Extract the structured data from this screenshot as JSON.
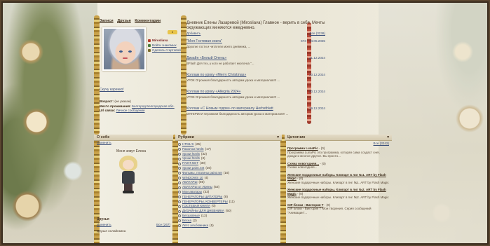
{
  "profile": {
    "tabs": [
      "Записи",
      "Друзья",
      "Комментарии"
    ],
    "username": "Mirosliava",
    "badge": "8",
    "actions": [
      {
        "icon": "person-icon",
        "label": "Mirosliava"
      },
      {
        "icon": "users-icon",
        "label": "Войти знакомых"
      },
      {
        "icon": "post-icon",
        "label": "Сделать стартовой"
      }
    ],
    "mood": "Скучу каренко!",
    "info": [
      {
        "label": "Возраст:",
        "value": "(не указан)"
      },
      {
        "label": "Место проживания:",
        "value": "Белгород Белгородская обл."
      },
      {
        "label": "Url связи:",
        "value": "Личное сообщение"
      }
    ]
  },
  "diary": {
    "title": "Дневник Елены Лазаревой (Mirosliava) Главное - верить в себя. Мечты окружающих меняются ежедневно.",
    "add_label": "Добавить",
    "count_label": "Все (3236)",
    "posts": [
      {
        "title": "\"Моя Гостевая книга\"",
        "desc": "Дорогие гости и читатели моего дневника, ...",
        "date_num": "673",
        "date": "14.05.2035"
      },
      {
        "title": "Дизайн «Белый Олень»",
        "desc": "BFlash Для тех, у кого не работает кнопочка \"...",
        "date_num": "",
        "date": "21.12.2024"
      },
      {
        "title": "Коллаж по уроку «Merry Christmas»",
        "desc": "УРОК Огромная благодарность авторам урока и материалов!!! ...",
        "date_num": "",
        "date": "20.12.2024"
      },
      {
        "title": "Коллаж по уроку «Allegria 2024»",
        "desc": "УРОК Огромная благодарность авторам урока и материалов!!! ...",
        "date_num": "",
        "date": "20.12.2024"
      },
      {
        "title": "Коллаж «С Новым годом» по материалу Herbstblatt",
        "desc": "МАТЕРИАЛ Огромная благодарность авторам урока и материалов!!! ...",
        "date_num": "",
        "date": "19.12.2024"
      }
    ]
  },
  "about": {
    "head": "О себе",
    "edit": "Изменить",
    "greeting": "Меня зовут Елена",
    "friends_head": "Друзья",
    "friends_edit": "Изменить",
    "friends_all": "Все (267)",
    "friends_online": "Друзья онлайнкина"
  },
  "categories": {
    "head": "Рубрики",
    "items": [
      {
        "label": "HTML'S",
        "count": "(25)"
      },
      {
        "label": "Рамочки html5",
        "count": "(17)"
      },
      {
        "label": "Уроки html5",
        "count": "(32)"
      },
      {
        "label": "Уроки html5",
        "count": "(3)"
      },
      {
        "label": "PAINT.NET",
        "count": "(30)"
      },
      {
        "label": "Уроки paint.net",
        "count": "(26)"
      },
      {
        "label": "Фильмы, плагины paint.net",
        "count": "(16)"
      },
      {
        "label": "WINDOWS 10",
        "count": "(4)"
      },
      {
        "label": "АВАТАРЫ",
        "count": "(86)"
      },
      {
        "label": "АВАТАРЫ от Ирены",
        "count": "(53)"
      },
      {
        "label": "Мои аватары",
        "count": "(33)"
      },
      {
        "label": "ГЕНЕРАТОРЫ ЦИТАТОРЫ",
        "count": "(8)"
      },
      {
        "label": "ГЕНЕРАТОРЫ, КОНВЕРТЕРЫ",
        "count": "(11)"
      },
      {
        "label": "ГОСТЕВАЯ КНИГА",
        "count": "(0)"
      },
      {
        "label": "ДИЗАЙНЫ ДЛЯ ДНЕВНИКА",
        "count": "(50)"
      },
      {
        "label": "Бесшовные",
        "count": "(13)"
      },
      {
        "label": "Весна",
        "count": "(2)"
      },
      {
        "label": "Лето альбомника",
        "count": "(5)"
      }
    ]
  },
  "quotes": {
    "head": "Цитатник",
    "all": "Все (3242)",
    "items": [
      {
        "title": "Программа LunaPic",
        "meta": " - (0)",
        "body": "Программа LunaPic это программа, которая сама создаст снег, дожди и многое другое. Вы просто..."
      },
      {
        "title": "Схема новогодняя...",
        "meta": " - (0)",
        "body": "Схема новогодняя..."
      },
      {
        "title": "Женские подарочные наборы. Клипарт в лиг №1. ART by Flash Magic",
        "meta": " - (0)",
        "body": "Женские подарочные наборы. Клипарт в пнг №1. ART by Flash Magic"
      },
      {
        "title": "Женские подарочные наборы. Клипарт в лиг №2. ART by Flash Magic",
        "meta": " - (0)",
        "body": "Женские подарочные наборы. Клипарт в пнг №2. ART by Flash Magic"
      },
      {
        "title": "GIF-блоки - Виктория Т",
        "meta": " - (0)",
        "body": "GIF блоки - Виктория Т Мои творения. Серия сообщений \"Анимации\"..."
      }
    ]
  },
  "colors": {
    "link": "#3b4f7a",
    "accent_red": "#b63c2c",
    "gold": "#c9a24a"
  }
}
